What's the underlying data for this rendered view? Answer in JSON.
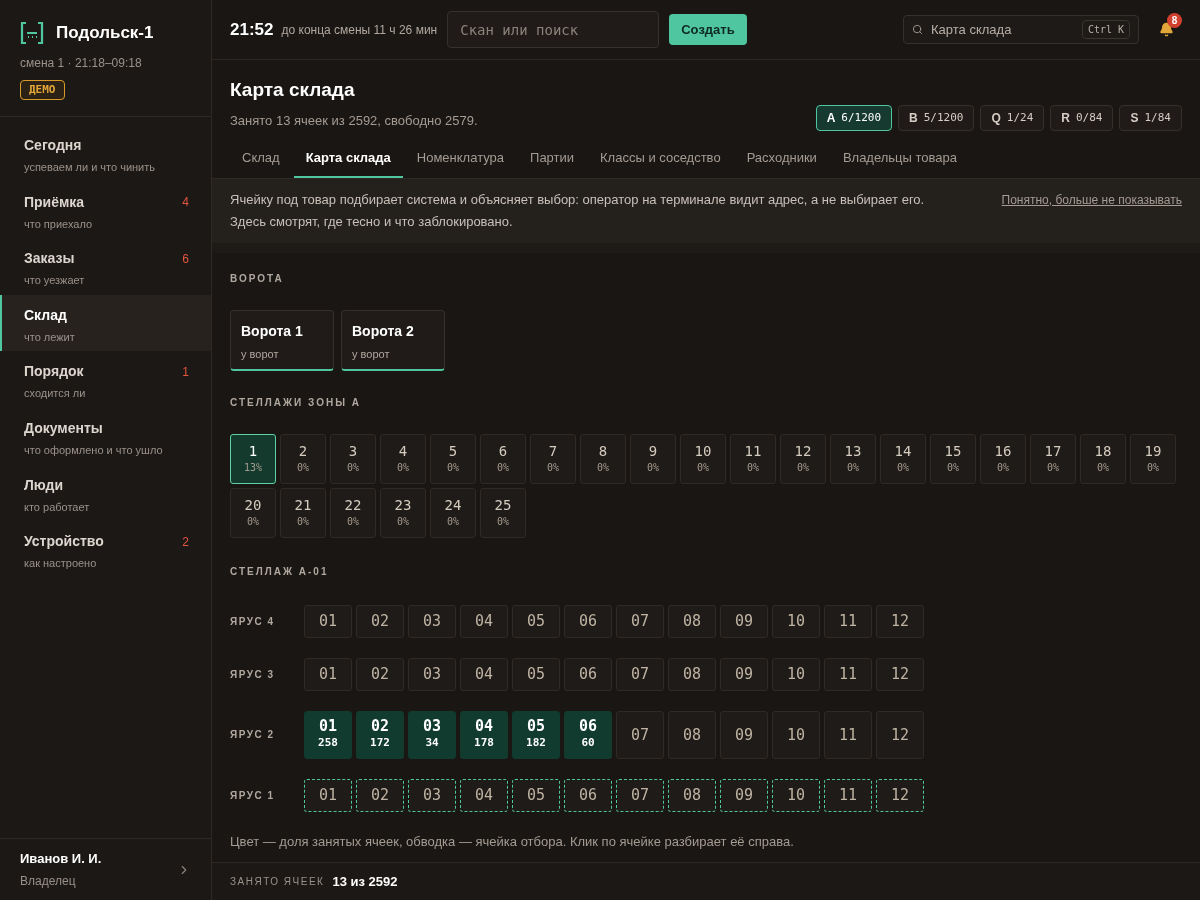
{
  "brand": {
    "name": "Подольск-1",
    "shift": "смена 1 · 21:18–09:18",
    "badge": "ДЕМО"
  },
  "nav": [
    {
      "label": "Сегодня",
      "sub": "успеваем ли и что чинить",
      "selected": false
    },
    {
      "label": "Приёмка",
      "sub": "что приехало",
      "count": "4",
      "selected": false
    },
    {
      "label": "Заказы",
      "sub": "что уезжает",
      "count": "6",
      "selected": false
    },
    {
      "label": "Склад",
      "sub": "что лежит",
      "selected": true
    },
    {
      "label": "Порядок",
      "sub": "сходится ли",
      "count": "1",
      "selected": false
    },
    {
      "label": "Документы",
      "sub": "что оформлено и что ушло",
      "selected": false
    },
    {
      "label": "Люди",
      "sub": "кто работает",
      "selected": false
    },
    {
      "label": "Устройство",
      "sub": "как настроено",
      "count": "2",
      "selected": false
    }
  ],
  "user": {
    "name": "Иванов И. И.",
    "role": "Владелец"
  },
  "topbar": {
    "time": "21:52",
    "countdown": "до конца смены 11 ч 26 мин",
    "scan_placeholder": "Скан или поиск",
    "create": "Создать",
    "search": "Карта склада",
    "shortcut": "Ctrl K",
    "notifications": "8"
  },
  "page": {
    "title": "Карта склада",
    "subtitle": "Занято 13 ячеек из 2592, свободно 2579."
  },
  "zones": [
    {
      "letter": "A",
      "count": "6/1200",
      "selected": true
    },
    {
      "letter": "B",
      "count": "5/1200",
      "selected": false
    },
    {
      "letter": "Q",
      "count": "1/24",
      "selected": false
    },
    {
      "letter": "R",
      "count": "0/84",
      "selected": false
    },
    {
      "letter": "S",
      "count": "1/84",
      "selected": false
    }
  ],
  "tabs": [
    {
      "label": "Склад",
      "selected": false
    },
    {
      "label": "Карта склада",
      "selected": true
    },
    {
      "label": "Номенклатура",
      "selected": false
    },
    {
      "label": "Партии",
      "selected": false
    },
    {
      "label": "Классы и соседство",
      "selected": false
    },
    {
      "label": "Расходники",
      "selected": false
    },
    {
      "label": "Владельцы товара",
      "selected": false
    }
  ],
  "notice": {
    "lines": [
      "Ячейку под товар подбирает система и объясняет выбор: оператор на терминале видит адрес, а не выбирает его.",
      "Здесь смотрят, где тесно и что заблокировано."
    ],
    "dismiss": "Понятно, больше не показывать"
  },
  "gates": {
    "title": "ВОРОТА",
    "items": [
      {
        "name": "Ворота 1",
        "sub": "у ворот"
      },
      {
        "name": "Ворота 2",
        "sub": "у ворот"
      }
    ]
  },
  "racks": {
    "title": "СТЕЛЛАЖИ ЗОНЫ A",
    "items": [
      {
        "num": "1",
        "pct": "13%",
        "selected": true
      },
      {
        "num": "2",
        "pct": "0%",
        "selected": false
      },
      {
        "num": "3",
        "pct": "0%",
        "selected": false
      },
      {
        "num": "4",
        "pct": "0%",
        "selected": false
      },
      {
        "num": "5",
        "pct": "0%",
        "selected": false
      },
      {
        "num": "6",
        "pct": "0%",
        "selected": false
      },
      {
        "num": "7",
        "pct": "0%",
        "selected": false
      },
      {
        "num": "8",
        "pct": "0%",
        "selected": false
      },
      {
        "num": "9",
        "pct": "0%",
        "selected": false
      },
      {
        "num": "10",
        "pct": "0%",
        "selected": false
      },
      {
        "num": "11",
        "pct": "0%",
        "selected": false
      },
      {
        "num": "12",
        "pct": "0%",
        "selected": false
      },
      {
        "num": "13",
        "pct": "0%",
        "selected": false
      },
      {
        "num": "14",
        "pct": "0%",
        "selected": false
      },
      {
        "num": "15",
        "pct": "0%",
        "selected": false
      },
      {
        "num": "16",
        "pct": "0%",
        "selected": false
      },
      {
        "num": "17",
        "pct": "0%",
        "selected": false
      },
      {
        "num": "18",
        "pct": "0%",
        "selected": false
      },
      {
        "num": "19",
        "pct": "0%",
        "selected": false
      },
      {
        "num": "20",
        "pct": "0%",
        "selected": false
      },
      {
        "num": "21",
        "pct": "0%",
        "selected": false
      },
      {
        "num": "22",
        "pct": "0%",
        "selected": false
      },
      {
        "num": "23",
        "pct": "0%",
        "selected": false
      },
      {
        "num": "24",
        "pct": "0%",
        "selected": false
      },
      {
        "num": "25",
        "pct": "0%",
        "selected": false
      }
    ]
  },
  "rack": {
    "title": "СТЕЛЛАЖ A-01",
    "tiers": [
      {
        "label": "ЯРУС 4",
        "pick": false,
        "cells": [
          {
            "num": "01",
            "filled": false
          },
          {
            "num": "02",
            "filled": false
          },
          {
            "num": "03",
            "filled": false
          },
          {
            "num": "04",
            "filled": false
          },
          {
            "num": "05",
            "filled": false
          },
          {
            "num": "06",
            "filled": false
          },
          {
            "num": "07",
            "filled": false
          },
          {
            "num": "08",
            "filled": false
          },
          {
            "num": "09",
            "filled": false
          },
          {
            "num": "10",
            "filled": false
          },
          {
            "num": "11",
            "filled": false
          },
          {
            "num": "12",
            "filled": false
          }
        ]
      },
      {
        "label": "ЯРУС 3",
        "pick": false,
        "cells": [
          {
            "num": "01",
            "filled": false
          },
          {
            "num": "02",
            "filled": false
          },
          {
            "num": "03",
            "filled": false
          },
          {
            "num": "04",
            "filled": false
          },
          {
            "num": "05",
            "filled": false
          },
          {
            "num": "06",
            "filled": false
          },
          {
            "num": "07",
            "filled": false
          },
          {
            "num": "08",
            "filled": false
          },
          {
            "num": "09",
            "filled": false
          },
          {
            "num": "10",
            "filled": false
          },
          {
            "num": "11",
            "filled": false
          },
          {
            "num": "12",
            "filled": false
          }
        ]
      },
      {
        "label": "ЯРУС 2",
        "pick": false,
        "cells": [
          {
            "num": "01",
            "qty": "258",
            "filled": true
          },
          {
            "num": "02",
            "qty": "172",
            "filled": true
          },
          {
            "num": "03",
            "qty": "34",
            "filled": true
          },
          {
            "num": "04",
            "qty": "178",
            "filled": true
          },
          {
            "num": "05",
            "qty": "182",
            "filled": true
          },
          {
            "num": "06",
            "qty": "60",
            "filled": true
          },
          {
            "num": "07",
            "filled": false
          },
          {
            "num": "08",
            "filled": false
          },
          {
            "num": "09",
            "filled": false
          },
          {
            "num": "10",
            "filled": false
          },
          {
            "num": "11",
            "filled": false
          },
          {
            "num": "12",
            "filled": false
          }
        ]
      },
      {
        "label": "ЯРУС 1",
        "pick": true,
        "cells": [
          {
            "num": "01",
            "filled": false
          },
          {
            "num": "02",
            "filled": false
          },
          {
            "num": "03",
            "filled": false
          },
          {
            "num": "04",
            "filled": false
          },
          {
            "num": "05",
            "filled": false
          },
          {
            "num": "06",
            "filled": false
          },
          {
            "num": "07",
            "filled": false
          },
          {
            "num": "08",
            "filled": false
          },
          {
            "num": "09",
            "filled": false
          },
          {
            "num": "10",
            "filled": false
          },
          {
            "num": "11",
            "filled": false
          },
          {
            "num": "12",
            "filled": false
          }
        ]
      }
    ],
    "legend": "Цвет — доля занятых ячеек, обводка — ячейка отбора. Клик по ячейке разбирает её справа."
  },
  "footer": {
    "label": "ЗАНЯТО ЯЧЕЕК",
    "value": "13 из 2592"
  }
}
